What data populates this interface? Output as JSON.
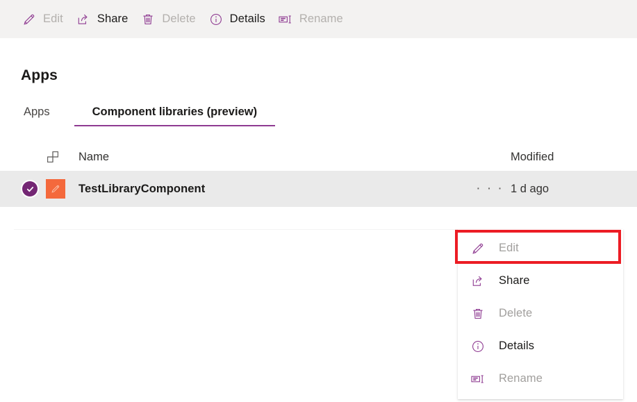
{
  "commandbar": {
    "items": [
      {
        "label": "Edit",
        "icon": "pencil-icon",
        "enabled": false
      },
      {
        "label": "Share",
        "icon": "share-icon",
        "enabled": true
      },
      {
        "label": "Delete",
        "icon": "trash-icon",
        "enabled": false
      },
      {
        "label": "Details",
        "icon": "info-icon",
        "enabled": true
      },
      {
        "label": "Rename",
        "icon": "rename-icon",
        "enabled": false
      }
    ]
  },
  "page": {
    "title": "Apps"
  },
  "tabs": [
    {
      "label": "Apps",
      "active": false
    },
    {
      "label": "Component libraries (preview)",
      "active": true
    }
  ],
  "list": {
    "columns": {
      "icon_header": "component-grid-icon",
      "name": "Name",
      "modified": "Modified"
    },
    "rows": [
      {
        "selected": true,
        "app_icon": "orange-pencil-app-icon",
        "name": "TestLibraryComponent",
        "overflow": "· · ·",
        "modified": "1 d ago"
      }
    ]
  },
  "context_menu": {
    "items": [
      {
        "label": "Edit",
        "icon": "pencil-icon",
        "enabled": false,
        "highlighted": true
      },
      {
        "label": "Share",
        "icon": "share-icon",
        "enabled": true,
        "highlighted": false
      },
      {
        "label": "Delete",
        "icon": "trash-icon",
        "enabled": false,
        "highlighted": false
      },
      {
        "label": "Details",
        "icon": "info-icon",
        "enabled": true,
        "highlighted": false
      },
      {
        "label": "Rename",
        "icon": "rename-icon",
        "enabled": false,
        "highlighted": false
      }
    ]
  },
  "colors": {
    "accent_purple": "#8e3a91",
    "selection_purple": "#742774",
    "app_tile_orange": "#f4693c",
    "commandbar_bg": "#f3f2f1",
    "row_selected_bg": "#eaeaea",
    "annotation_red": "#ec1c24"
  }
}
